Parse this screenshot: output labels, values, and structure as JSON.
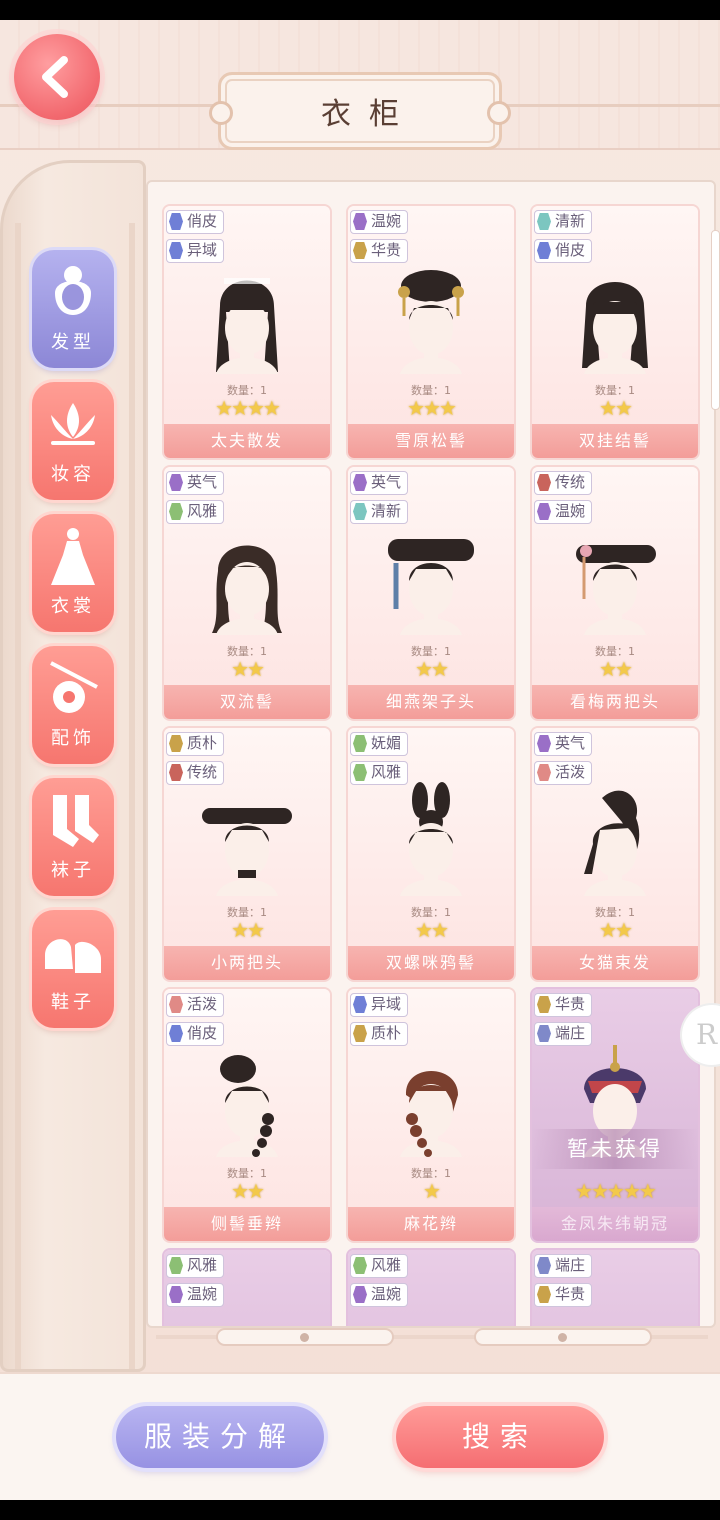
{
  "header": {
    "title": "衣柜",
    "back_icon": "chevron-left-icon"
  },
  "sidebar": {
    "items": [
      {
        "label": "发型",
        "icon": "hair-icon",
        "active": true
      },
      {
        "label": "妆容",
        "icon": "lotus-icon",
        "active": false
      },
      {
        "label": "衣裳",
        "icon": "dress-icon",
        "active": false
      },
      {
        "label": "配饰",
        "icon": "accessory-icon",
        "active": false
      },
      {
        "label": "袜子",
        "icon": "socks-icon",
        "active": false
      },
      {
        "label": "鞋子",
        "icon": "shoes-icon",
        "active": false
      }
    ]
  },
  "tag_colors": {
    "俏皮": "#6f7fd6",
    "异域": "#6f7fd6",
    "温婉": "#9a6fc7",
    "华贵": "#c9a24a",
    "清新": "#7cc6c0",
    "英气": "#9a6fc7",
    "风雅": "#8cbf74",
    "传统": "#c9645c",
    "质朴": "#c9a24a",
    "妩媚": "#8cbf74",
    "活泼": "#e08a86",
    "端庄": "#7f89c9"
  },
  "grid": {
    "quantity_label": "数量：1",
    "locked_label": "暂未获得",
    "items": [
      {
        "tags": [
          "俏皮",
          "异域"
        ],
        "stars": 4,
        "name": "太夫散发",
        "locked": false,
        "style": "loose-long"
      },
      {
        "tags": [
          "温婉",
          "华贵"
        ],
        "stars": 3,
        "name": "雪原松髻",
        "locked": false,
        "style": "bun-pins"
      },
      {
        "tags": [
          "清新",
          "俏皮"
        ],
        "stars": 2,
        "name": "双挂结髻",
        "locked": false,
        "style": "long-bangs"
      },
      {
        "tags": [
          "英气",
          "风雅"
        ],
        "stars": 2,
        "name": "双流髻",
        "locked": false,
        "style": "long-wavy"
      },
      {
        "tags": [
          "英气",
          "清新"
        ],
        "stars": 2,
        "name": "细燕架子头",
        "locked": false,
        "style": "qing-board"
      },
      {
        "tags": [
          "传统",
          "温婉"
        ],
        "stars": 2,
        "name": "看梅两把头",
        "locked": false,
        "style": "qing-board-flower"
      },
      {
        "tags": [
          "质朴",
          "传统"
        ],
        "stars": 2,
        "name": "小两把头",
        "locked": false,
        "style": "qing-board-plain"
      },
      {
        "tags": [
          "妩媚",
          "风雅"
        ],
        "stars": 2,
        "name": "双螺咪鸦髻",
        "locked": false,
        "style": "double-bun"
      },
      {
        "tags": [
          "英气",
          "活泼"
        ],
        "stars": 2,
        "name": "女猫束发",
        "locked": false,
        "style": "ponytail"
      },
      {
        "tags": [
          "活泼",
          "俏皮"
        ],
        "stars": 2,
        "name": "侧髻垂辫",
        "locked": false,
        "style": "side-braid"
      },
      {
        "tags": [
          "异域",
          "质朴"
        ],
        "stars": 1,
        "name": "麻花辫",
        "locked": false,
        "style": "red-braid"
      },
      {
        "tags": [
          "华贵",
          "端庄"
        ],
        "stars": 5,
        "name": "金凤朱纬朝冠",
        "locked": true,
        "style": "crown"
      },
      {
        "tags": [
          "风雅",
          "温婉"
        ],
        "stars": 0,
        "name": "",
        "locked": true,
        "style": "none"
      },
      {
        "tags": [
          "风雅",
          "温婉"
        ],
        "stars": 0,
        "name": "",
        "locked": true,
        "style": "none"
      },
      {
        "tags": [
          "端庄",
          "华贵"
        ],
        "stars": 0,
        "name": "",
        "locked": true,
        "style": "none"
      }
    ]
  },
  "side_bubble": {
    "label": "R"
  },
  "footer": {
    "decompose_label": "服装分解",
    "search_label": "搜索"
  }
}
